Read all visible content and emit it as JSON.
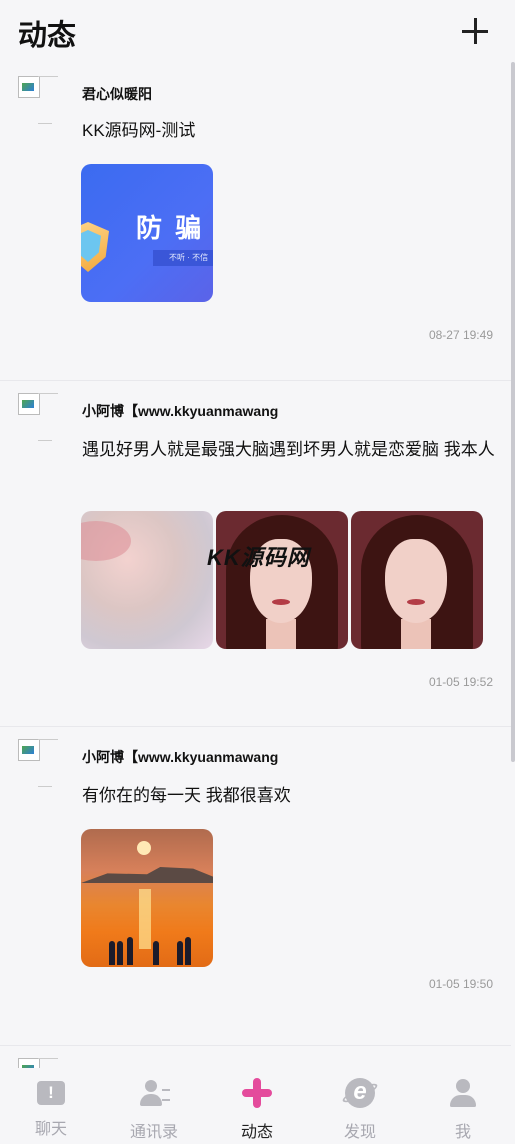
{
  "header": {
    "title": "动态",
    "add_icon": "plus-icon"
  },
  "posts": [
    {
      "username": "君心似暖阳",
      "content": "KK源码网-测试",
      "image_text": {
        "big": "防 骗",
        "small": "不听 · 不信"
      },
      "time": "08-27 19:49"
    },
    {
      "username": "小阿博【www.kkyuanmawang",
      "content": "遇见好男人就是最强大脑遇到坏男人就是恋爱脑 我本人",
      "time": "01-05 19:52"
    },
    {
      "username": "小阿博【www.kkyuanmawang",
      "content": "有你在的每一天 我都很喜欢",
      "time": "01-05 19:50"
    }
  ],
  "watermark": "KK源码网",
  "tabbar": {
    "items": [
      {
        "label": "聊天",
        "icon": "chat-icon"
      },
      {
        "label": "通讯录",
        "icon": "contacts-icon"
      },
      {
        "label": "动态",
        "icon": "moments-icon",
        "active": true
      },
      {
        "label": "发现",
        "icon": "discover-icon"
      },
      {
        "label": "我",
        "icon": "me-icon"
      }
    ]
  },
  "colors": {
    "background": "#f6f6f8",
    "active_icon": "#e44b9c",
    "inactive": "#a8a8b0",
    "time": "#9a9a9a"
  }
}
